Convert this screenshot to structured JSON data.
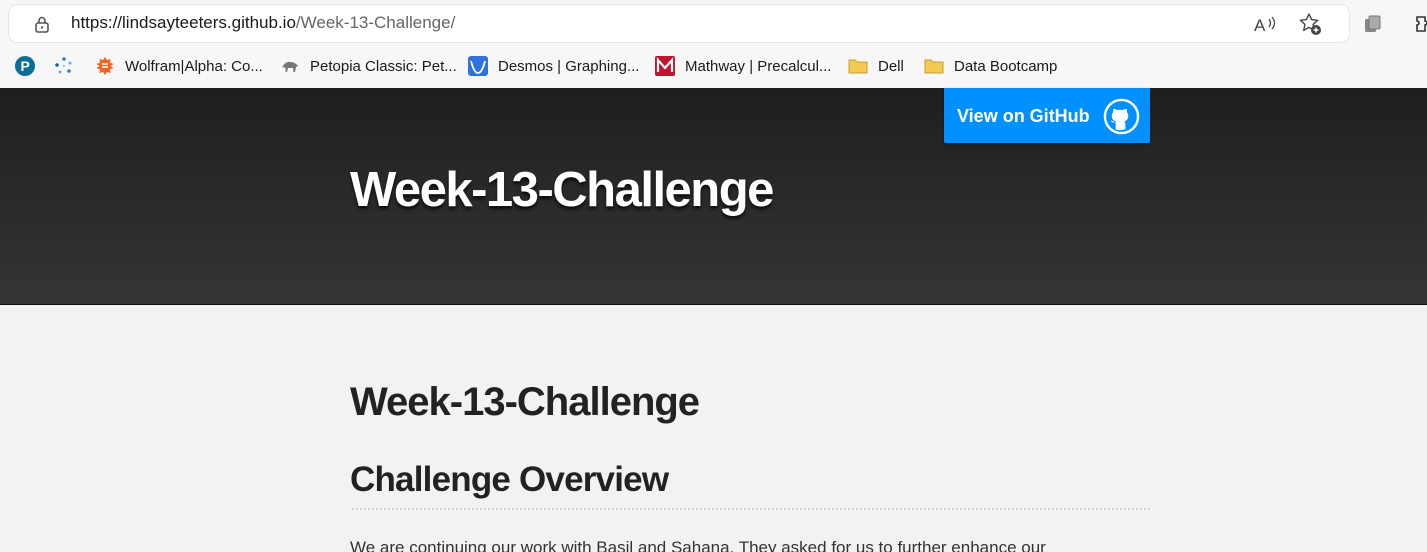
{
  "browser": {
    "url_host": "https://lindsayteeters.github.io",
    "url_path": "/Week-13-Challenge/",
    "toolbar_icons": [
      "lock-icon",
      "read-aloud-icon",
      "add-favorite-icon",
      "collections-icon",
      "extensions-icon"
    ]
  },
  "bookmarks": [
    {
      "label": "",
      "icon": "pearson-icon",
      "color": "#0a6f97"
    },
    {
      "label": "",
      "icon": "sparkle-icon",
      "color": "#2d7fc7"
    },
    {
      "label": "Wolfram|Alpha: Co...",
      "icon": "wolfram-icon",
      "color": "#f26522"
    },
    {
      "label": "Petopia Classic: Pet...",
      "icon": "petopia-icon",
      "color": "#777777"
    },
    {
      "label": "Desmos | Graphing...",
      "icon": "desmos-icon",
      "color": "#2f72dc"
    },
    {
      "label": "Mathway | Precalcul...",
      "icon": "mathway-icon",
      "color": "#c4122f"
    },
    {
      "label": "Dell",
      "icon": "folder-icon",
      "color": "#f4c94f"
    },
    {
      "label": "Data Bootcamp",
      "icon": "folder-icon",
      "color": "#f4c94f"
    }
  ],
  "header": {
    "github_button_label": "View on GitHub",
    "project_title": "Week-13-Challenge",
    "button_color": "#0090ff"
  },
  "main": {
    "heading": "Week-13-Challenge",
    "subheading": "Challenge Overview",
    "paragraph": "We are continuing our work with Basil and Sahana. They asked for us to further enhance our"
  }
}
